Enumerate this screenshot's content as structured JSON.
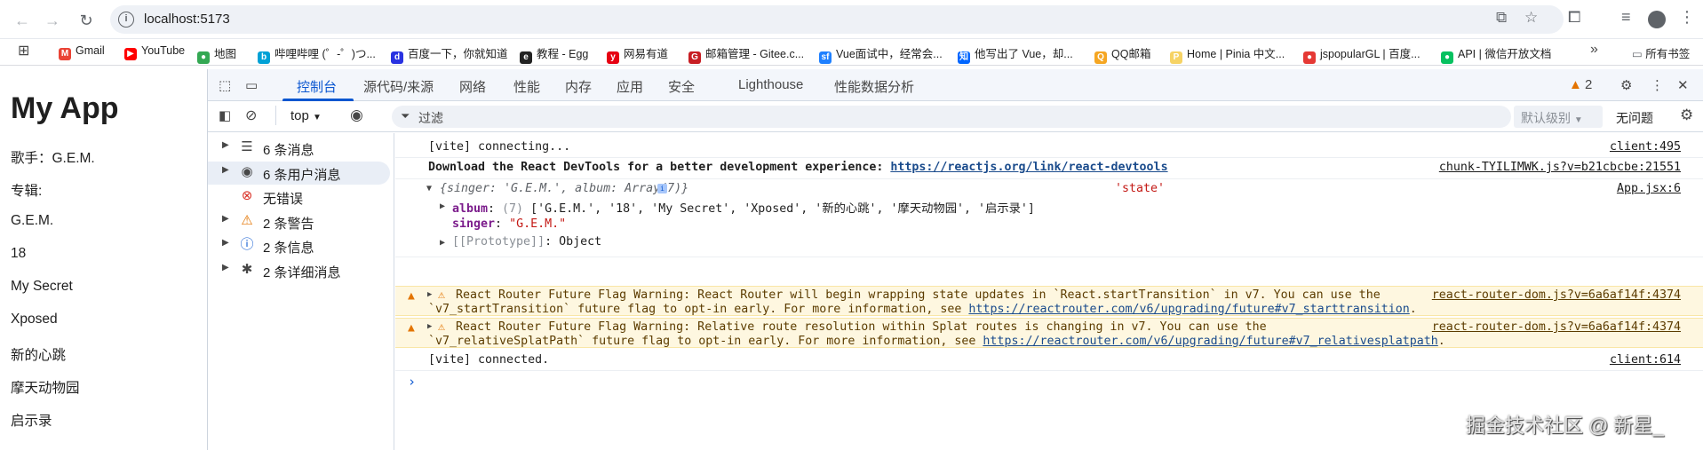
{
  "browser": {
    "url": "localhost:5173",
    "bookmarks": [
      {
        "label": "Gmail",
        "color": "#ea4335",
        "glyph": "M"
      },
      {
        "label": "YouTube",
        "color": "#ff0000",
        "glyph": "▶"
      },
      {
        "label": "地图",
        "color": "#34a853",
        "glyph": "●"
      },
      {
        "label": "哔哩哔哩 (゜-゜)つ...",
        "color": "#00a1d6",
        "glyph": "b"
      },
      {
        "label": "百度一下，你就知道",
        "color": "#2932e1",
        "glyph": "d"
      },
      {
        "label": "教程 - Egg",
        "color": "#222222",
        "glyph": "e"
      },
      {
        "label": "网易有道",
        "color": "#e60012",
        "glyph": "y"
      },
      {
        "label": "邮箱管理 - Gitee.c...",
        "color": "#c71d23",
        "glyph": "G"
      },
      {
        "label": "Vue面试中，经常会...",
        "color": "#1e80ff",
        "glyph": "sf"
      },
      {
        "label": "他写出了 Vue，却...",
        "color": "#0066ff",
        "glyph": "知"
      },
      {
        "label": "QQ邮箱",
        "color": "#f5a623",
        "glyph": "Q"
      },
      {
        "label": "Home | Pinia 中文...",
        "color": "#f6d365",
        "glyph": "P"
      },
      {
        "label": "jspopularGL | 百度...",
        "color": "#e53935",
        "glyph": "●"
      },
      {
        "label": "API | 微信开放文档",
        "color": "#07c160",
        "glyph": "●"
      }
    ],
    "more_bookmarks_label": "»",
    "all_bookmarks_label": "所有书签"
  },
  "page": {
    "title": "My App",
    "items": [
      "歌手：G.E.M.",
      "专辑:",
      "G.E.M.",
      "18",
      "My Secret",
      "Xposed",
      "新的心跳",
      "摩天动物园",
      "启示录"
    ]
  },
  "devtools": {
    "tabs": [
      "控制台",
      "源代码/来源",
      "网络",
      "性能",
      "内存",
      "应用",
      "安全",
      "Lighthouse",
      "性能数据分析"
    ],
    "issues_count": "2",
    "context": "top",
    "filter_placeholder": "过滤",
    "levels_label": "默认级别",
    "no_issues_label": "无问题",
    "sidebar": [
      {
        "label": "6 条消息",
        "icon": "list-icon",
        "expandable": true
      },
      {
        "label": "6 条用户消息",
        "icon": "user-icon",
        "expandable": true
      },
      {
        "label": "无错误",
        "icon": "error-icon",
        "expandable": false
      },
      {
        "label": "2 条警告",
        "icon": "warning-icon",
        "expandable": true
      },
      {
        "label": "2 条信息",
        "icon": "info-icon",
        "expandable": true
      },
      {
        "label": "2 条详细消息",
        "icon": "bug-icon",
        "expandable": true
      }
    ],
    "console": {
      "vite_connecting": "[vite] connecting...",
      "vite_connecting_src": "client:495",
      "devtools_msg": "Download the React DevTools for a better development experience: ",
      "devtools_link": "https://reactjs.org/link/react-devtools",
      "devtools_src": "chunk-TYILIMWK.js?v=b21cbcbe:21551",
      "obj_preview": "{singer: 'G.E.M.', album: Array(7)}",
      "obj_label": "'state'",
      "obj_src": "App.jsx:6",
      "album_key": "album",
      "album_count": "(7)",
      "album_values": "['G.E.M.', '18', 'My Secret', 'Xposed', '新的心跳', '摩天动物园', '启示录']",
      "singer_key": "singer",
      "singer_value": "\"G.E.M.\"",
      "proto_key": "[[Prototype]]",
      "proto_value": "Object",
      "warn1_line1": "React Router Future Flag Warning: React Router will begin wrapping state updates in `React.startTransition` in v7. You can use the",
      "warn1_line2": "`v7_startTransition` future flag to opt-in early. For more information, see ",
      "warn1_link": "https://reactrouter.com/v6/upgrading/future#v7_starttransition",
      "warn1_src": "react-router-dom.js?v=6a6af14f:4374",
      "warn2_line1": "React Router Future Flag Warning: Relative route resolution within Splat routes is changing in v7. You can use the",
      "warn2_line2": "`v7_relativeSplatPath` future flag to opt-in early. For more information, see ",
      "warn2_link": "https://reactrouter.com/v6/upgrading/future#v7_relativesplatpath",
      "warn2_src": "react-router-dom.js?v=6a6af14f:4374",
      "vite_connected": "[vite] connected.",
      "vite_connected_src": "client:614",
      "prompt": "›"
    }
  },
  "watermark": "掘金技术社区 @ 新星_"
}
